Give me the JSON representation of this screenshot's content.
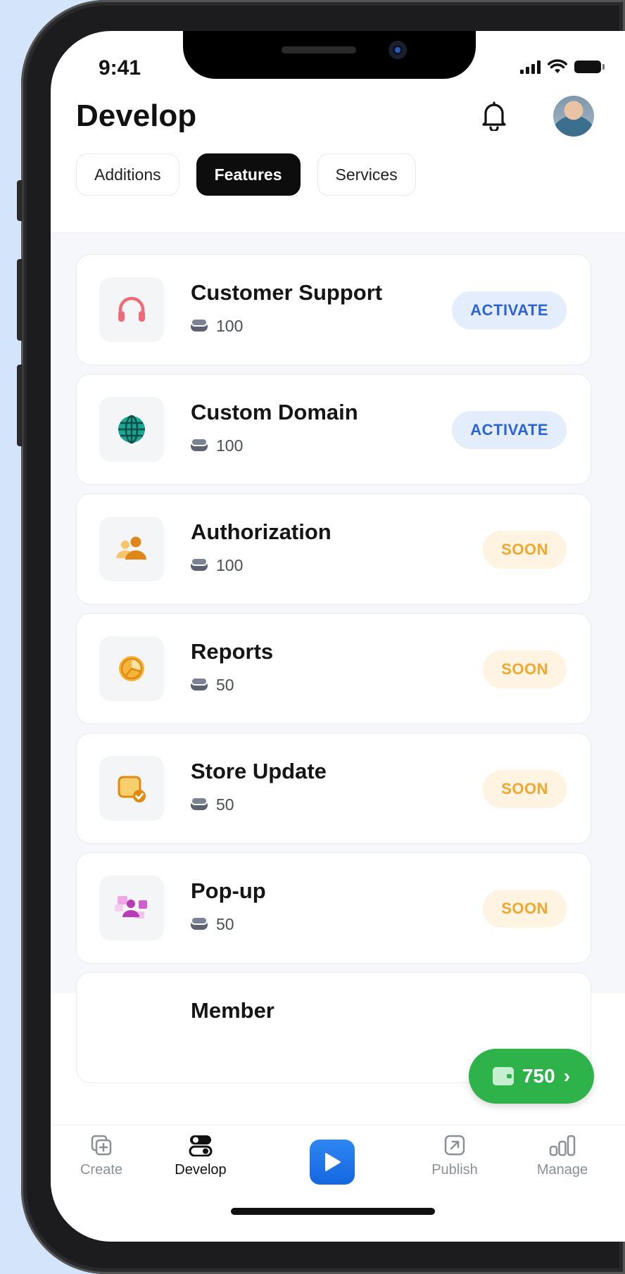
{
  "status": {
    "time": "9:41"
  },
  "header": {
    "title": "Develop"
  },
  "tabs": [
    {
      "label": "Additions",
      "active": false
    },
    {
      "label": "Features",
      "active": true
    },
    {
      "label": "Services",
      "active": false
    }
  ],
  "features": [
    {
      "title": "Customer Support",
      "cost": "100",
      "action": "ACTIVATE",
      "icon": "headphones-icon",
      "color": "#f06a78"
    },
    {
      "title": "Custom Domain",
      "cost": "100",
      "action": "ACTIVATE",
      "icon": "globe-icon",
      "color": "#1aa595"
    },
    {
      "title": "Authorization",
      "cost": "100",
      "action": "SOON",
      "icon": "users-icon",
      "color": "#f0a13a"
    },
    {
      "title": "Reports",
      "cost": "50",
      "action": "SOON",
      "icon": "pie-chart-icon",
      "color": "#f5b43a"
    },
    {
      "title": "Store Update",
      "cost": "50",
      "action": "SOON",
      "icon": "store-update-icon",
      "color": "#f3a52d"
    },
    {
      "title": "Pop-up",
      "cost": "50",
      "action": "SOON",
      "icon": "popup-icon",
      "color": "#c64fc0"
    },
    {
      "title": "Member",
      "cost": "",
      "action": "",
      "icon": "",
      "color": ""
    }
  ],
  "wallet": {
    "balance": "750",
    "chevron": "›"
  },
  "bottom_nav": [
    {
      "label": "Create",
      "icon": "add-square-icon",
      "active": false
    },
    {
      "label": "Develop",
      "icon": "toggle-icon",
      "active": true
    },
    {
      "label": "",
      "icon": "play-icon",
      "active": false
    },
    {
      "label": "Publish",
      "icon": "export-icon",
      "active": false
    },
    {
      "label": "Manage",
      "icon": "bar-chart-icon",
      "active": false
    }
  ],
  "colors": {
    "accent": "#2c63d8",
    "soon": "#f0a830",
    "wallet": "#2eb24a",
    "background": "#d3e4fb"
  }
}
